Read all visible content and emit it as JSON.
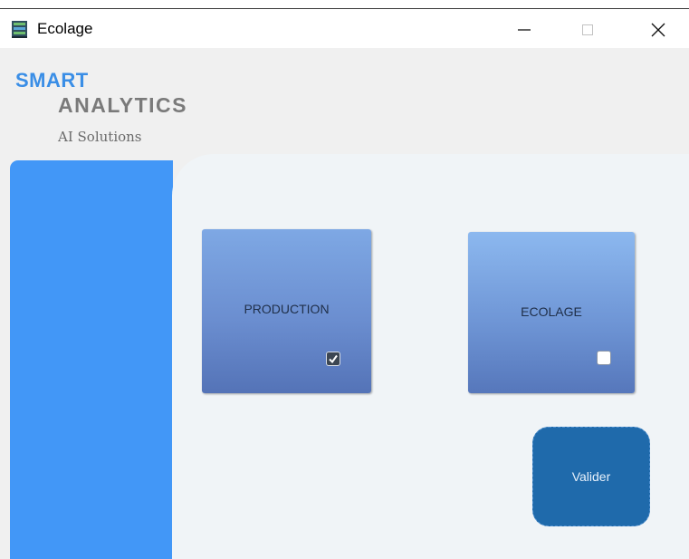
{
  "window": {
    "title": "Ecolage",
    "controls": {
      "minimize": "minimize-icon",
      "maximize": "maximize-icon",
      "close": "close-icon"
    }
  },
  "branding": {
    "line1": "SMART",
    "line2": "ANALYTICS",
    "tagline": "AI Solutions"
  },
  "options": [
    {
      "label": "PRODUCTION",
      "checked": true
    },
    {
      "label": "ECOLAGE",
      "checked": false
    }
  ],
  "actions": {
    "validate_label": "Valider"
  },
  "colors": {
    "sidebar": "#4297f7",
    "tile": "#6b8ed0",
    "button": "#1f6aab",
    "brand_blue": "#3a8ee6",
    "brand_gray": "#7a7a7a"
  }
}
